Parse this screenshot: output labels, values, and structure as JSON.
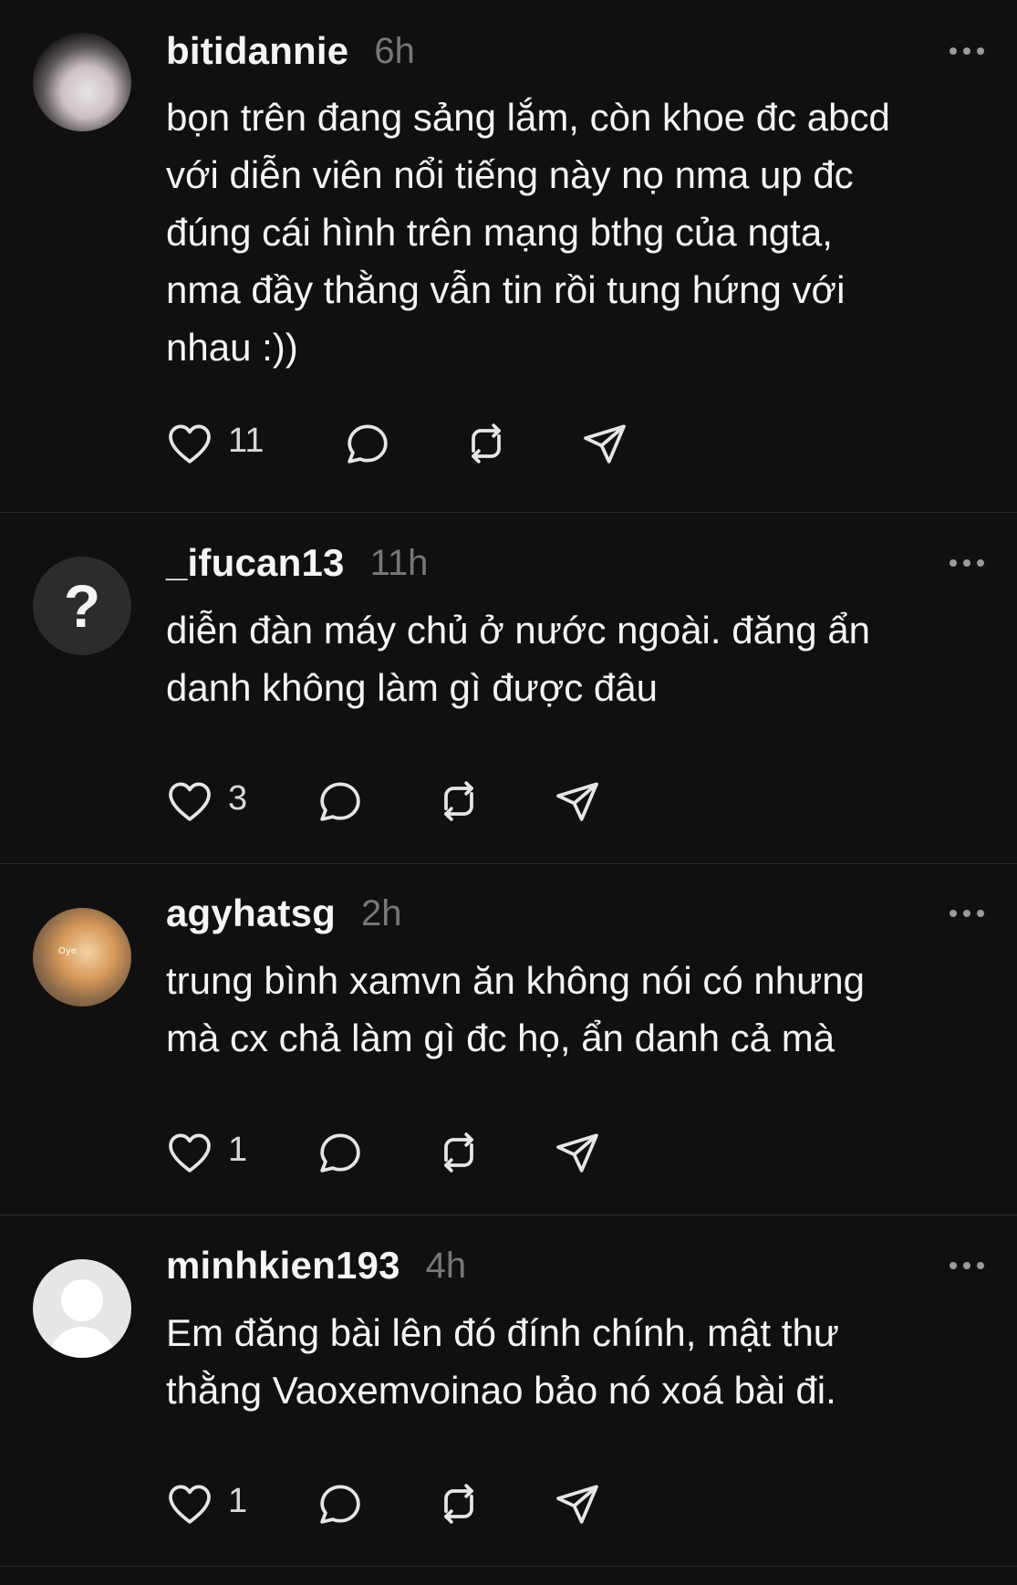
{
  "posts": [
    {
      "username": "bitidannie",
      "time": "6h",
      "text": "bọn trên đang sảng lắm, còn khoe đc abcd\nvới diễn viên nổi tiếng này nọ nma up đc\nđúng cái hình trên mạng bthg của ngta,\nnma đầy thằng vẫn tin rồi tung hứng với\nnhau :))",
      "likes": "11",
      "avatar": "photo"
    },
    {
      "username": "_ifucan13",
      "time": "11h",
      "text": "diễn đàn máy chủ ở nước ngoài. đăng ẩn\ndanh không làm gì được đâu",
      "likes": "3",
      "avatar": "question-mark",
      "avatar_glyph": "?"
    },
    {
      "username": "agyhatsg",
      "time": "2h",
      "text": "trung bình xamvn ăn không nói có nhưng\nmà cx chả làm gì đc họ, ẩn danh cả mà",
      "likes": "1",
      "avatar": "cat-photo",
      "avatar_caption": "Oye"
    },
    {
      "username": "minhkien193",
      "time": "4h",
      "text": "Em đăng bài lên đó đính chính, mật thư\nthằng Vaoxemvoinao bảo nó xoá bài đi.",
      "likes": "1",
      "avatar": "default-user"
    }
  ],
  "icons": {
    "more": "more-horizontal-icon",
    "like": "heart-icon",
    "reply": "comment-icon",
    "repost": "repost-icon",
    "share": "send-icon"
  },
  "colors": {
    "background": "#101010",
    "text": "#f3f5f7",
    "muted": "#777777",
    "divider": "#2b2b2b"
  }
}
